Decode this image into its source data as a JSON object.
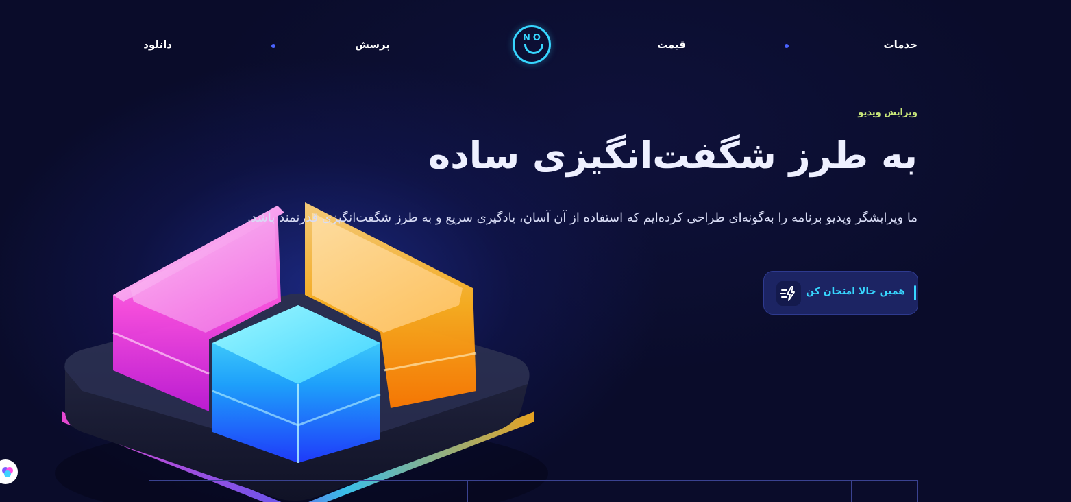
{
  "nav": {
    "items": [
      {
        "label": "خدمات"
      },
      {
        "label": "قیمت"
      },
      {
        "label": "پرسش"
      },
      {
        "label": "دانلود"
      }
    ],
    "logo_text": "NO",
    "accent": "#37d6ff",
    "dot_color": "#4b63ff"
  },
  "hero": {
    "eyebrow": "ویرایش ویدیو",
    "headline": "به طرز شگفت‌انگیزی ساده",
    "subtitle": "ما ویرایشگر ویدیو برنامه را به‌گونه‌ای طراحی کرده‌ایم که استفاده از آن آسان، یادگیری سریع و به طرز شگفت‌انگیزی قدرتمند باشد.",
    "cta_label": "همین حالا امتحان کن",
    "cta_icon": "lightning-icon"
  },
  "colors": {
    "background": "#0a0c2a",
    "eyebrow": "#c9e77a",
    "cta_bg": "#1c2463",
    "cta_text": "#37d6ff"
  },
  "illustration": {
    "icon": "glowing-cubes-illustration"
  },
  "widget": {
    "icon": "brain-icon"
  }
}
